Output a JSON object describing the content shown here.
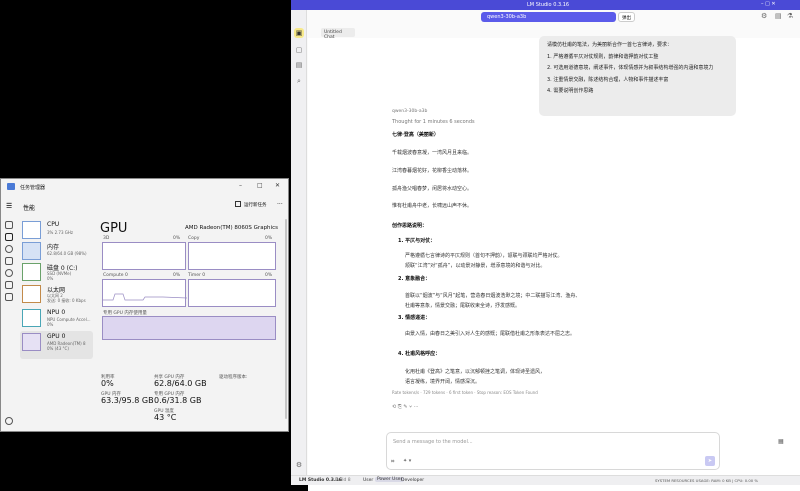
{
  "task_manager": {
    "title": "任务管理器",
    "search_label": "性能",
    "run_task_label": "运行新任务",
    "more": "···",
    "sidebar": [
      {
        "name": "CPU",
        "sub": "3%  2.73 GHz"
      },
      {
        "name": "内存",
        "sub": "62.8/64.0 GB (98%)"
      },
      {
        "name": "磁盘 0 (C:)",
        "sub": "SSD (NVMe)",
        "sub2": "0%"
      },
      {
        "name": "以太网",
        "sub": "以太网 2",
        "sub2": "发送: 0 接收: 0 Kbps"
      },
      {
        "name": "NPU 0",
        "sub": "NPU Compute Accel...",
        "sub2": "0%"
      },
      {
        "name": "GPU 0",
        "sub": "AMD Radeon(TM) 8",
        "sub2": "0% (43 °C)"
      }
    ],
    "gpu": {
      "heading": "GPU",
      "model": "AMD Radeon(TM) 8060S Graphics",
      "graph_labels": [
        "3D",
        "Copy",
        "Compute 0",
        "Timer 0"
      ],
      "graph_pcts": [
        "0%",
        "0%",
        "0%",
        "0%"
      ],
      "memory_label": "专用 GPU 内存使用量",
      "stats": {
        "util_label": "利用率",
        "util_value": "0%",
        "shared_label": "共享 GPU 内存",
        "shared_value": "62.8/64.0 GB",
        "gpu_mem_label": "GPU 内存",
        "gpu_mem_value": "63.3/95.8 GB",
        "dedicated_label": "专用 GPU 内存",
        "dedicated_value": "0.6/31.8 GB",
        "temp_label": "GPU 温度",
        "temp_value": "43 °C",
        "driver_label": "驱动程序版本:"
      }
    }
  },
  "lm_studio": {
    "app_title": "LM Studio 0.3.16",
    "model_chip": "qwen3-30b-a3b",
    "eject": "弹出",
    "tab_name": "Untitled Chat",
    "prompt_heading": "请模仿杜甫的笔法，为美丽新合作一首七言律诗，要求：",
    "prompt_items": [
      "1. 严格遵循平仄对仗规则，韵律和谐押韵对仗工整",
      "2. 可选用道德意境，阐述事件，体现情感并为叙事结构增强的内涵和意境力",
      "3. 注重情景交融，陈述结构合理，人物和事件描述丰富",
      "4. 需要说明创作思路"
    ],
    "model_name": "qwen3-30b-a3b",
    "thought": "Thought for 1 minutes 6 seconds",
    "poem_title": "七律·登高（美丽新）",
    "poem_lines": [
      "千载烟波春意凝，一湾风月且来临。",
      "江湾春暮烟花好，花柳香尘动落林。",
      "孤舟渔父唱春梦，闲居将水动空心。",
      "惟有杜甫舟中老，长啸远山声不休。"
    ],
    "notes_title": "创作思路说明：",
    "notes": [
      {
        "h": "1. 平仄与对仗：",
        "t1": "严格遵循七言律诗的平仄规则（首句不押韵），颔联与颈联均严格对仗。",
        "t2": "颔联“江湾”对“孤舟”，以动景对静景，增添意境的和谐与对比。"
      },
      {
        "h": "2. 意象融合：",
        "t1": "首联以“烟波”与“风月”起笔，营造春日烟波浩渺之境；中二联描写江湾、渔舟、",
        "t2": "杜甫等意象，情景交融；尾联收束全诗，抒发感慨。"
      },
      {
        "h": "3. 情感递进：",
        "t1": "由景入情，由春日之美引入对人生的感慨；尾联借杜甫之形象表达不屈之志。"
      },
      {
        "h": "4. 杜甫风格呼应：",
        "t1": "化用杜甫《登高》之笔意，以沉郁顿挫之笔调，体现诗圣遗风，",
        "t2": "语言凝练，境界开阔，情感深沉。"
      }
    ],
    "stats_line": "Rate tokens/s · 729 tokens · 6 first token · Stop reason: EOS Token Found",
    "input_placeholder": "Send a message to the model...",
    "statusbar": {
      "app": "LM Studio 0.3.16",
      "build": "Build 8",
      "user": "User",
      "power_user": "Power User",
      "developer": "Developer",
      "right": "SYSTEM RESOURCES USAGE:  RAM: 0 KB | CPU: 0.00 %"
    }
  }
}
